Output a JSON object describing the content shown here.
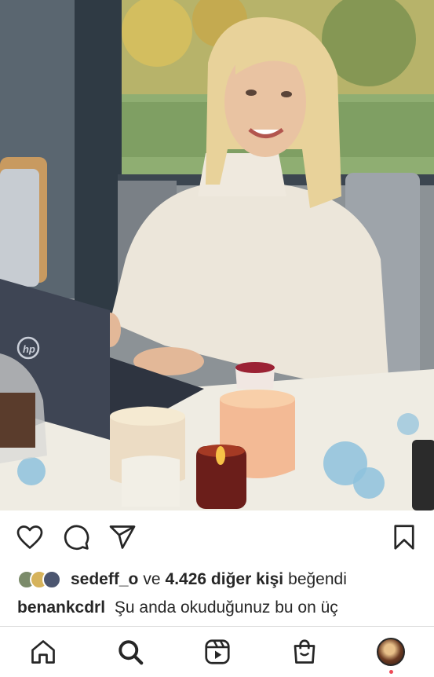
{
  "post": {
    "photo": {
      "icon": "post-photo",
      "laptop_logo": "hp"
    },
    "actions": {
      "like_icon": "heart-icon",
      "comment_icon": "comment-icon",
      "share_icon": "send-icon",
      "save_icon": "bookmark-icon"
    },
    "likes": {
      "user": "sedeff_o",
      "separator": "ve",
      "count": "4.426 diğer kişi",
      "suffix": "beğendi"
    },
    "caption": {
      "username": "benankcdrl",
      "text": "Şu anda okuduğunuz bu on üç"
    }
  },
  "bottom_nav": {
    "items": [
      {
        "name": "home",
        "icon": "home-icon"
      },
      {
        "name": "search",
        "icon": "search-icon"
      },
      {
        "name": "reels",
        "icon": "reels-icon"
      },
      {
        "name": "shop",
        "icon": "shop-icon"
      },
      {
        "name": "profile",
        "icon": "profile-avatar"
      }
    ]
  },
  "colors": {
    "text": "#262626",
    "divider": "#dbdbdb",
    "notification_dot": "#ed4956"
  }
}
